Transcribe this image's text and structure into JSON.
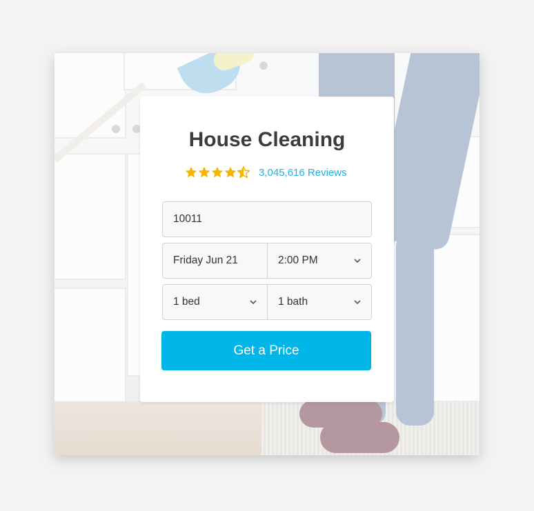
{
  "card": {
    "title": "House Cleaning",
    "rating": {
      "stars": 4.5,
      "star_color": "#f5b400"
    },
    "reviews_label": "3,045,616 Reviews"
  },
  "form": {
    "zip": "10011",
    "date": "Friday Jun 21",
    "time": "2:00 PM",
    "beds": "1 bed",
    "baths": "1 bath",
    "submit_label": "Get a Price"
  },
  "colors": {
    "accent": "#00b6e9",
    "link": "#1fb2dd"
  }
}
